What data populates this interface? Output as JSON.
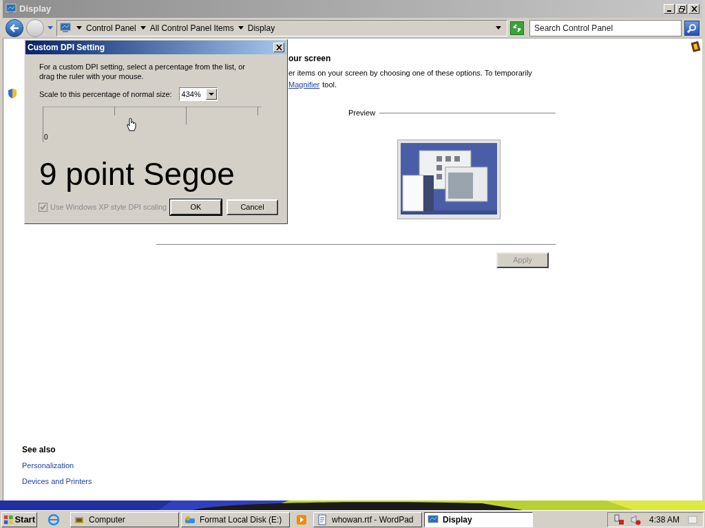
{
  "window": {
    "title": "Display"
  },
  "address_bar": {
    "breadcrumbs": [
      "Control Panel",
      "All Control Panel Items",
      "Display"
    ]
  },
  "search": {
    "placeholder": "Search Control Panel"
  },
  "content": {
    "heading": "our screen",
    "description": "er items on your screen by choosing one of these options. To temporarily",
    "link": "Magnifier",
    "link_suffix": "tool."
  },
  "preview": {
    "label": "Preview"
  },
  "apply_button": {
    "label": "Apply",
    "disabled": true
  },
  "see_also": {
    "title": "See also",
    "links": [
      "Personalization",
      "Devices and Printers"
    ]
  },
  "dialog": {
    "title": "Custom DPI Setting",
    "instructions": "For a custom DPI setting, select a percentage from the list, or drag the ruler with your mouse.",
    "scale_label": "Scale to this percentage of normal size:",
    "scale_value": "434%",
    "ruler_label": "0",
    "sample_text": "9 point Segoe",
    "xp_scaling": {
      "label": "Use Windows XP style DPI scaling",
      "checked": true,
      "disabled": true
    },
    "buttons": [
      "OK",
      "Cancel"
    ]
  },
  "taskbar": {
    "start": "Start",
    "tasks": [
      {
        "label": "Computer",
        "selected": false
      },
      {
        "label": "Format Local Disk (E:)",
        "selected": false
      },
      {
        "label": "whowan.rtf - WordPad",
        "selected": false
      },
      {
        "label": "Display",
        "selected": true
      }
    ],
    "clock": "4:38 AM"
  }
}
